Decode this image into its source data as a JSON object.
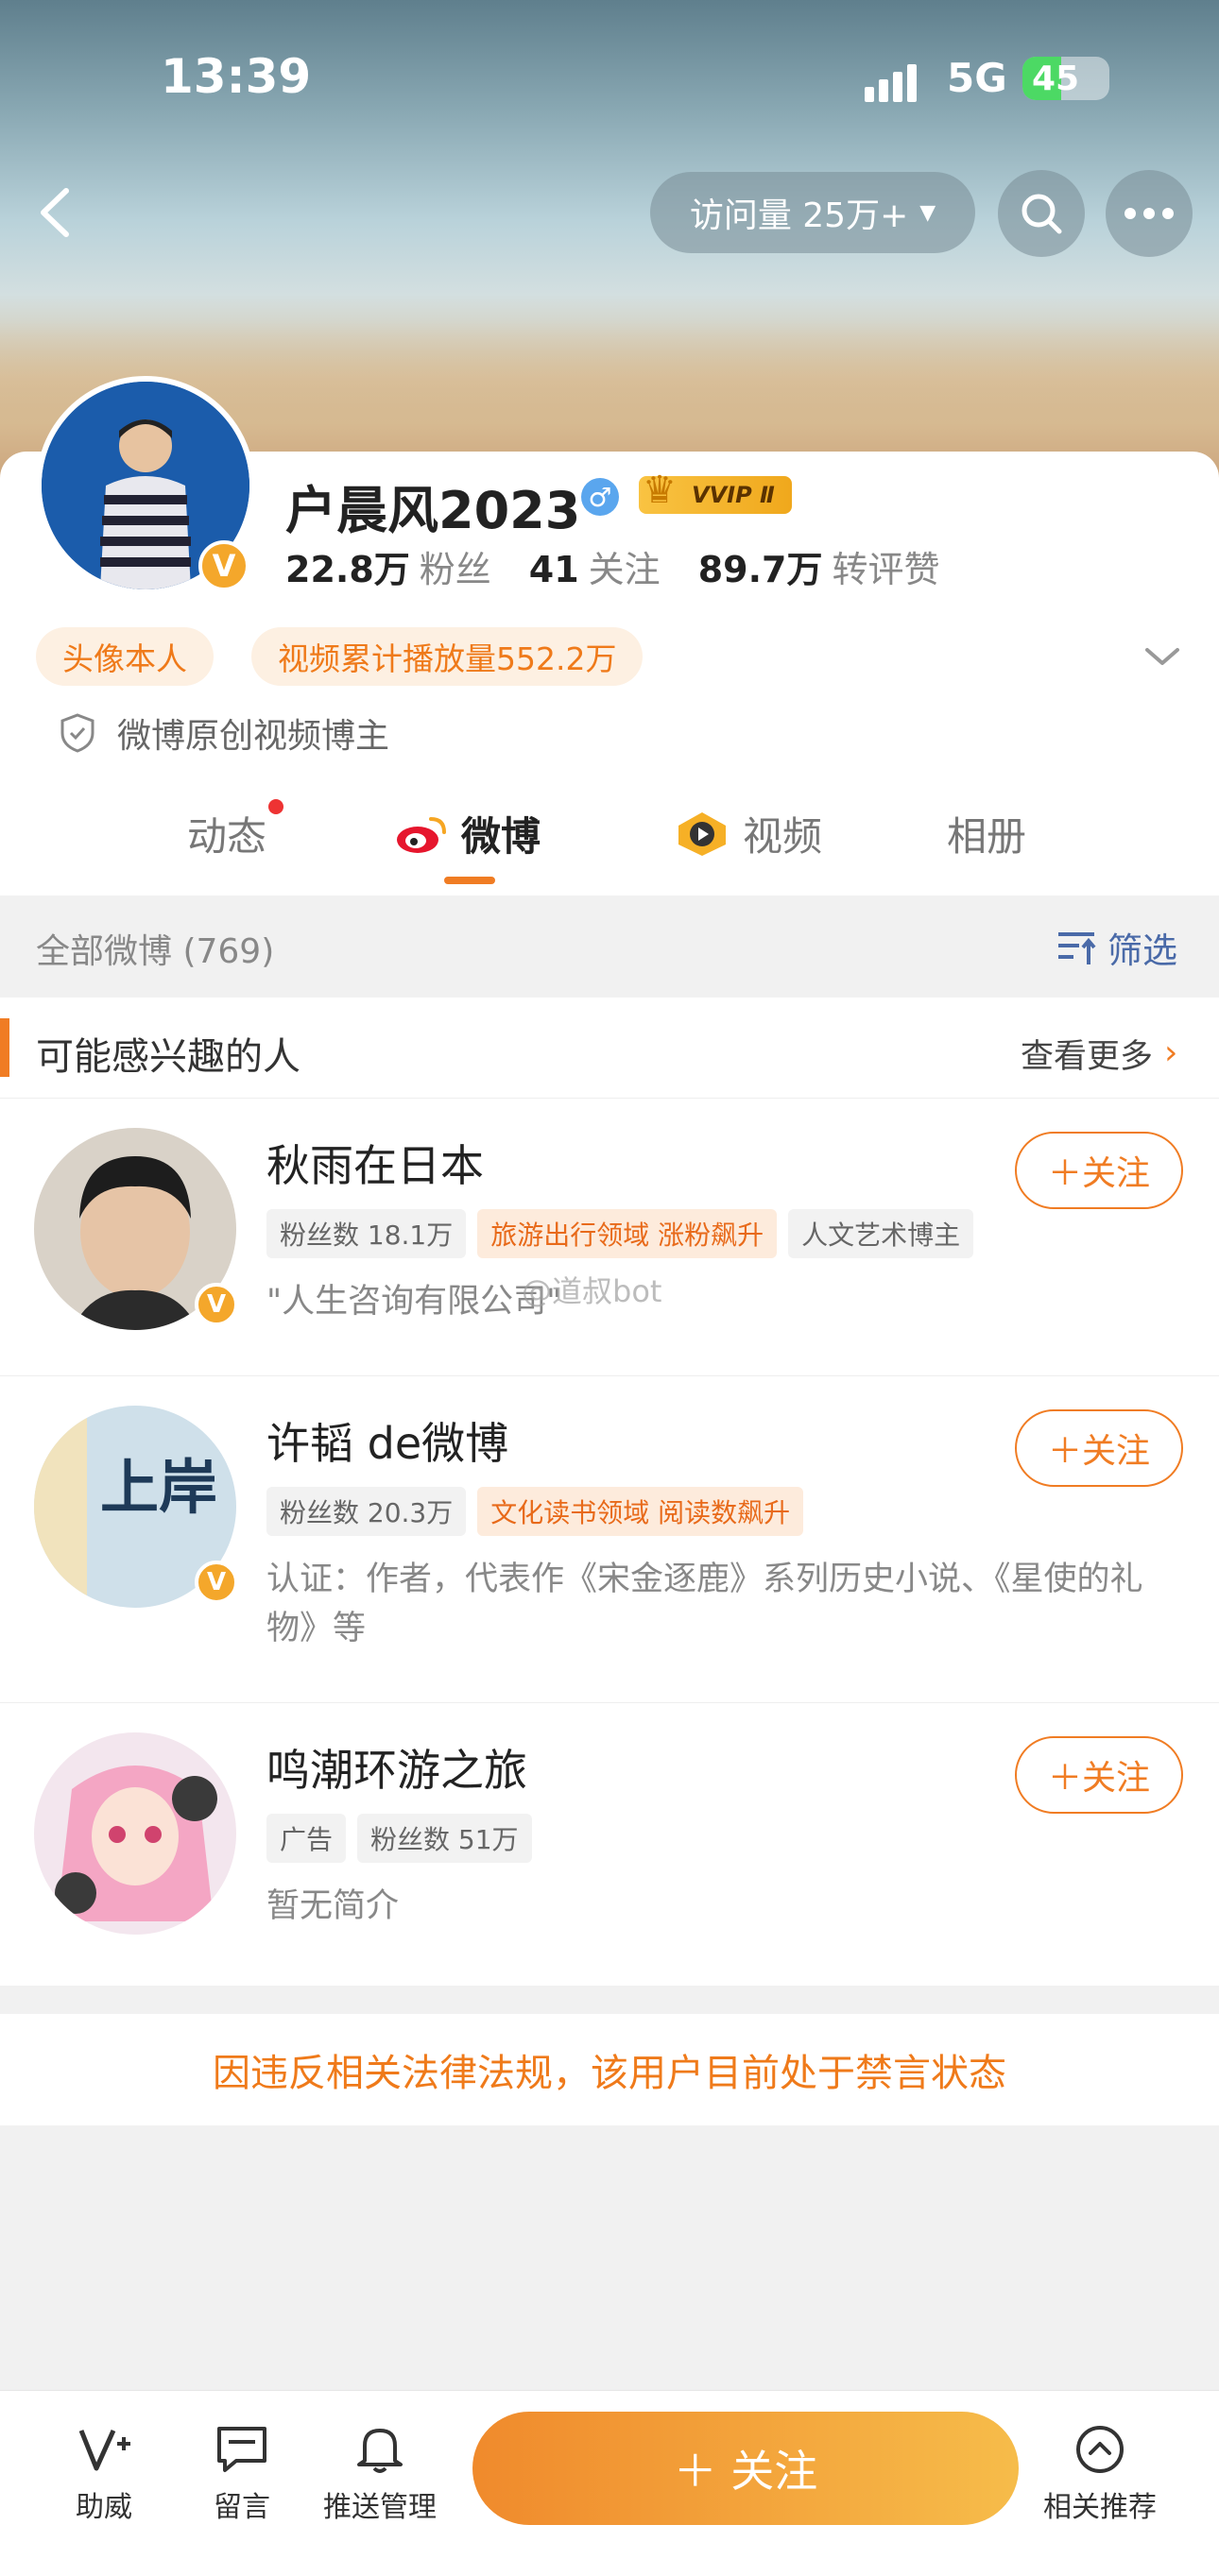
{
  "status_bar": {
    "time": "13:39",
    "network": "5G",
    "battery": "45",
    "battery_level": 0.45
  },
  "header": {
    "visits_label": "访问量 25万+"
  },
  "profile": {
    "name": "户晨风2023",
    "gender_symbol": "♂",
    "vip_label": "VVIP Ⅱ",
    "stats": [
      {
        "value": "22.8万",
        "label": "粉丝"
      },
      {
        "value": "41",
        "label": "关注"
      },
      {
        "value": "89.7万",
        "label": "转评赞"
      }
    ],
    "tags": [
      "头像本人",
      "视频累计播放量552.2万"
    ],
    "verification": "微博原创视频博主"
  },
  "tabs": [
    "动态",
    "微博",
    "视频",
    "相册"
  ],
  "filter_bar": {
    "all_label": "全部微博 (769)",
    "filter_label": "筛选"
  },
  "recommend": {
    "title": "可能感兴趣的人",
    "more_label": "查看更多",
    "follow_label": "＋关注",
    "people": [
      {
        "name": "秋雨在日本",
        "tags": [
          {
            "text": "粉丝数 18.1万",
            "hot": false
          },
          {
            "text": "旅游出行领域 涨粉飙升",
            "hot": true
          },
          {
            "text": "人文艺术博主",
            "hot": false
          }
        ],
        "desc": "\"人生咨询有限公司\""
      },
      {
        "name": "许韬 de微博",
        "tags": [
          {
            "text": "粉丝数 20.3万",
            "hot": false
          },
          {
            "text": "文化读书领域 阅读数飙升",
            "hot": true
          }
        ],
        "desc": "认证：作者，代表作《宋金逐鹿》系列历史小说、《星使的礼物》等",
        "avatar_text": "上岸"
      },
      {
        "name": "鸣潮环游之旅",
        "tags": [
          {
            "text": "广告",
            "hot": false
          },
          {
            "text": "粉丝数 51万",
            "hot": false
          }
        ],
        "desc": "暂无简介"
      }
    ]
  },
  "watermark": "@道叔bot",
  "ban_notice": "因违反相关法律法规，该用户目前处于禁言状态",
  "bottom_bar": {
    "items": [
      "助威",
      "留言",
      "推送管理"
    ],
    "follow_label": "＋ 关注",
    "related_label": "相关推荐"
  },
  "colors": {
    "accent": "#f07c23",
    "tag_bg": "#fdf0e2",
    "link": "#4a6aa8"
  }
}
